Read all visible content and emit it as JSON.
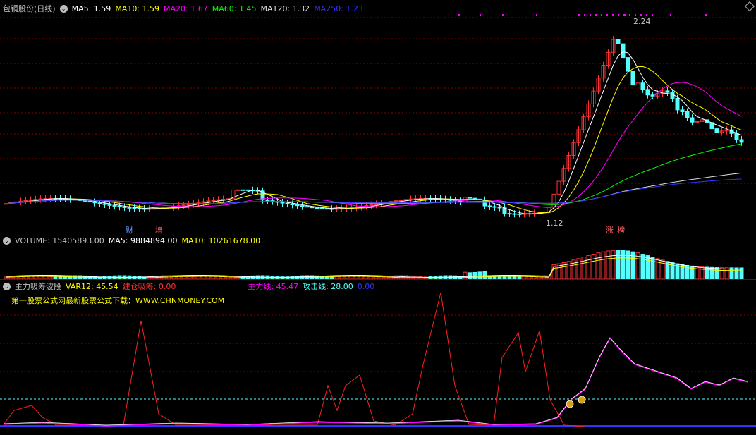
{
  "price_panel": {
    "stock_name": "包钢股份(日线)",
    "ma": [
      {
        "label": "MA5: 1.59",
        "color": "#ffffff"
      },
      {
        "label": "MA10: 1.59",
        "color": "#ffff00"
      },
      {
        "label": "MA20: 1.67",
        "color": "#ff00ff"
      },
      {
        "label": "MA60: 1.45",
        "color": "#00ff00"
      },
      {
        "label": "MA120: 1.32",
        "color": "#dddddd"
      },
      {
        "label": "MA250: 1.23",
        "color": "#3333ff"
      }
    ],
    "high_label": "2.24",
    "low_label": "1.12",
    "event_tags": [
      {
        "text": "财",
        "color": "#6699ff"
      },
      {
        "text": "增",
        "color": "#ff6666"
      },
      {
        "text": "涨",
        "color": "#ff6666"
      },
      {
        "text": "榜",
        "color": "#ff6666"
      }
    ]
  },
  "volume_panel": {
    "title": "VOLUME: 15405893.00",
    "ma5": "MA5: 9884894.00",
    "ma10": "MA10: 10261678.00"
  },
  "indicator_panel": {
    "title": "主力吸筹波段",
    "var12": "VAR12: 45.54",
    "jc": "建仓吸筹: 0.00",
    "zl": "主力线: 45.47",
    "gj": "攻击线: 28.00",
    "last": "0.00",
    "ad": "第一股票公式网最新股票公式下载：WWW.CHNMONEY.COM"
  },
  "colors": {
    "up": "#ff3232",
    "down": "#54ffff",
    "grid": "#8b0000"
  }
}
